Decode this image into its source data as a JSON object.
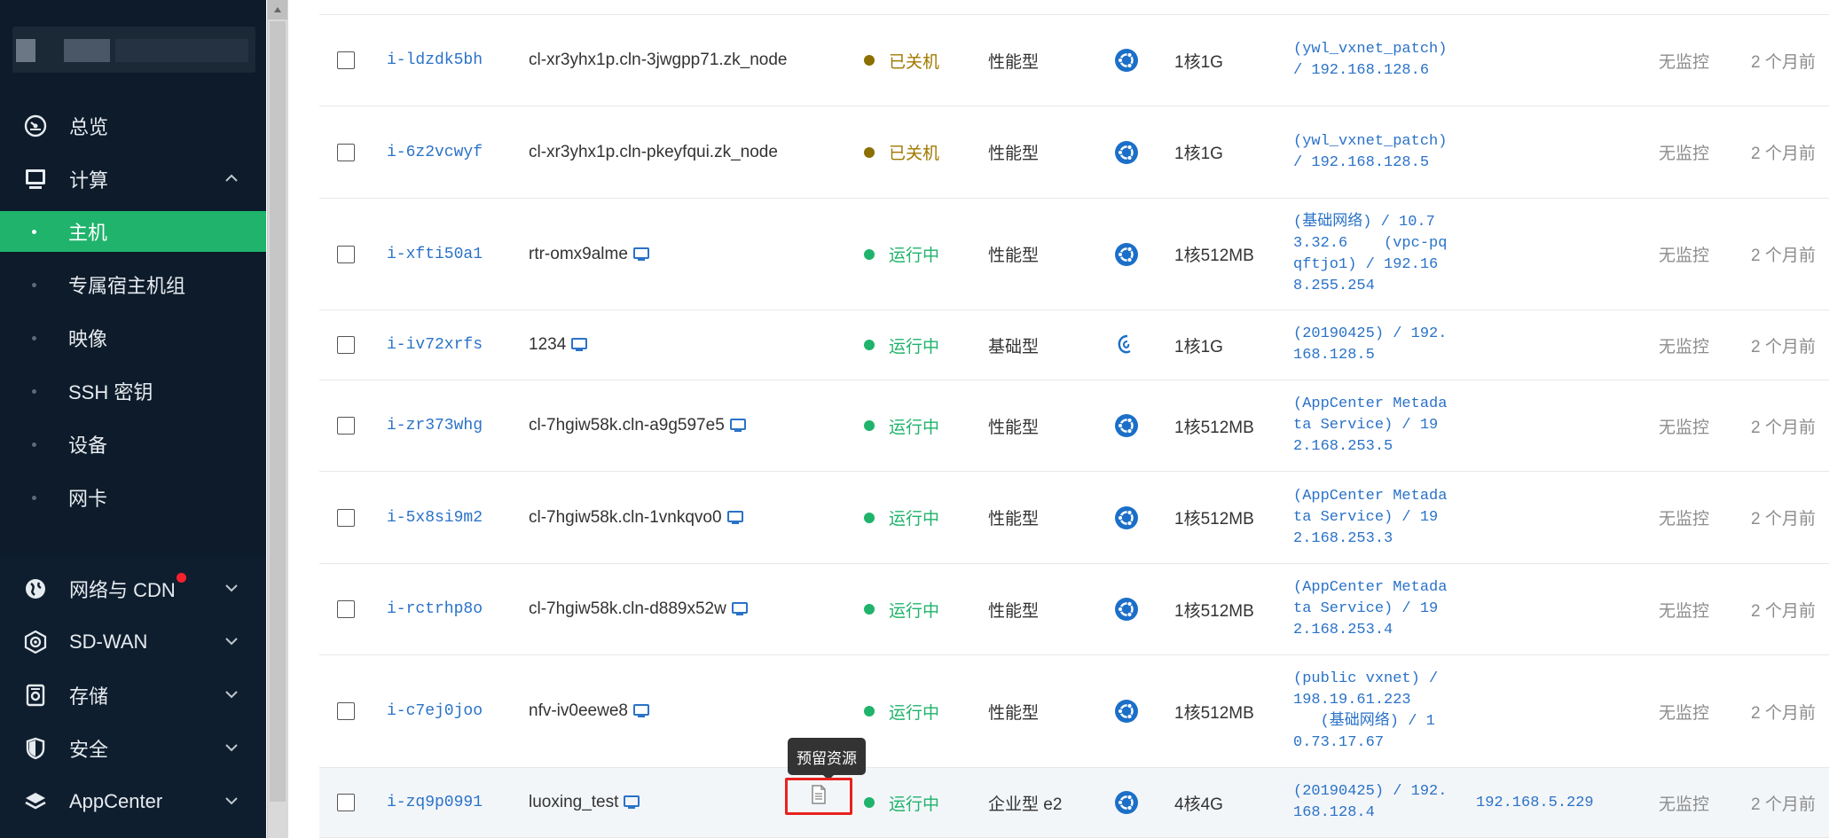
{
  "sidebar": {
    "nav": [
      {
        "label": "总览",
        "icon": "gauge-icon"
      },
      {
        "label": "计算",
        "icon": "monitor-icon",
        "expanded": true
      },
      {
        "label": "网络与 CDN",
        "icon": "globe-icon",
        "badge": true
      },
      {
        "label": "SD-WAN",
        "icon": "sdwan-icon"
      },
      {
        "label": "存储",
        "icon": "storage-icon"
      },
      {
        "label": "安全",
        "icon": "shield-icon"
      },
      {
        "label": "AppCenter",
        "icon": "layers-icon"
      }
    ],
    "compute_items": [
      "主机",
      "专属宿主机组",
      "映像",
      "SSH 密钥",
      "设备",
      "网卡"
    ],
    "active_item": "主机"
  },
  "colors": {
    "sidebar_bg": "#0d1b2a",
    "active_green": "#1fb36b",
    "running": "#1fb36b",
    "stopped": "#a07800",
    "stopped_dot": "#8b6f00",
    "link": "#2a72c8",
    "highlight_border": "#e8211d"
  },
  "tooltip": {
    "text": "预留资源"
  },
  "instances": [
    {
      "id": "i-ldzdk5bh",
      "name": "cl-xr3yhx1p.cln-3jwgpp71.zk_node",
      "has_console": false,
      "status": "已关机",
      "state": "stopped",
      "type": "性能型",
      "os": "ubuntu",
      "config": "1核1G",
      "network": [
        "(ywl_vxnet_patch)",
        "/ 192.168.128.6"
      ],
      "eip": "",
      "monitor": "无监控",
      "created": "2 个月前"
    },
    {
      "id": "i-6z2vcwyf",
      "name": "cl-xr3yhx1p.cln-pkeyfqui.zk_node",
      "has_console": false,
      "status": "已关机",
      "state": "stopped",
      "type": "性能型",
      "os": "ubuntu",
      "config": "1核1G",
      "network": [
        "(ywl_vxnet_patch)",
        "/ 192.168.128.5"
      ],
      "eip": "",
      "monitor": "无监控",
      "created": "2 个月前"
    },
    {
      "id": "i-xfti50a1",
      "name": "rtr-omx9alme",
      "has_console": true,
      "status": "运行中",
      "state": "running",
      "type": "性能型",
      "os": "ubuntu",
      "config": "1核512MB",
      "network": [
        "(基础网络) / 10.7",
        "3.32.6    (vpc-pq",
        "qftjo1) / 192.16",
        "8.255.254"
      ],
      "eip": "",
      "monitor": "无监控",
      "created": "2 个月前"
    },
    {
      "id": "i-iv72xrfs",
      "name": "1234",
      "has_console": true,
      "status": "运行中",
      "state": "running",
      "type": "基础型",
      "os": "debian",
      "config": "1核1G",
      "network": [
        "(20190425) / 192.",
        "168.128.5"
      ],
      "eip": "",
      "monitor": "无监控",
      "created": "2 个月前"
    },
    {
      "id": "i-zr373whg",
      "name": "cl-7hgiw58k.cln-a9g597e5",
      "has_console": true,
      "status": "运行中",
      "state": "running",
      "type": "性能型",
      "os": "ubuntu",
      "config": "1核512MB",
      "network": [
        "(AppCenter Metada",
        "ta Service) / 19",
        "2.168.253.5"
      ],
      "eip": "",
      "monitor": "无监控",
      "created": "2 个月前"
    },
    {
      "id": "i-5x8si9m2",
      "name": "cl-7hgiw58k.cln-1vnkqvo0",
      "has_console": true,
      "status": "运行中",
      "state": "running",
      "type": "性能型",
      "os": "ubuntu",
      "config": "1核512MB",
      "network": [
        "(AppCenter Metada",
        "ta Service) / 19",
        "2.168.253.3"
      ],
      "eip": "",
      "monitor": "无监控",
      "created": "2 个月前"
    },
    {
      "id": "i-rctrhp8o",
      "name": "cl-7hgiw58k.cln-d889x52w",
      "has_console": true,
      "status": "运行中",
      "state": "running",
      "type": "性能型",
      "os": "ubuntu",
      "config": "1核512MB",
      "network": [
        "(AppCenter Metada",
        "ta Service) / 19",
        "2.168.253.4"
      ],
      "eip": "",
      "monitor": "无监控",
      "created": "2 个月前"
    },
    {
      "id": "i-c7ej0joo",
      "name": "nfv-iv0eewe8",
      "has_console": true,
      "status": "运行中",
      "state": "running",
      "type": "性能型",
      "os": "ubuntu",
      "config": "1核512MB",
      "network": [
        "(public vxnet) /",
        "198.19.61.223",
        "   (基础网络) / 1",
        "0.73.17.67"
      ],
      "eip": "",
      "monitor": "无监控",
      "created": "2 个月前"
    },
    {
      "id": "i-zq9p0991",
      "name": "luoxing_test",
      "has_console": true,
      "reserved": true,
      "status": "运行中",
      "state": "running",
      "type": "企业型 e2",
      "os": "ubuntu",
      "config": "4核4G",
      "network": [
        "(20190425) / 192.",
        "168.128.4"
      ],
      "eip": "192.168.5.229",
      "monitor": "无监控",
      "created": "2 个月前"
    }
  ]
}
